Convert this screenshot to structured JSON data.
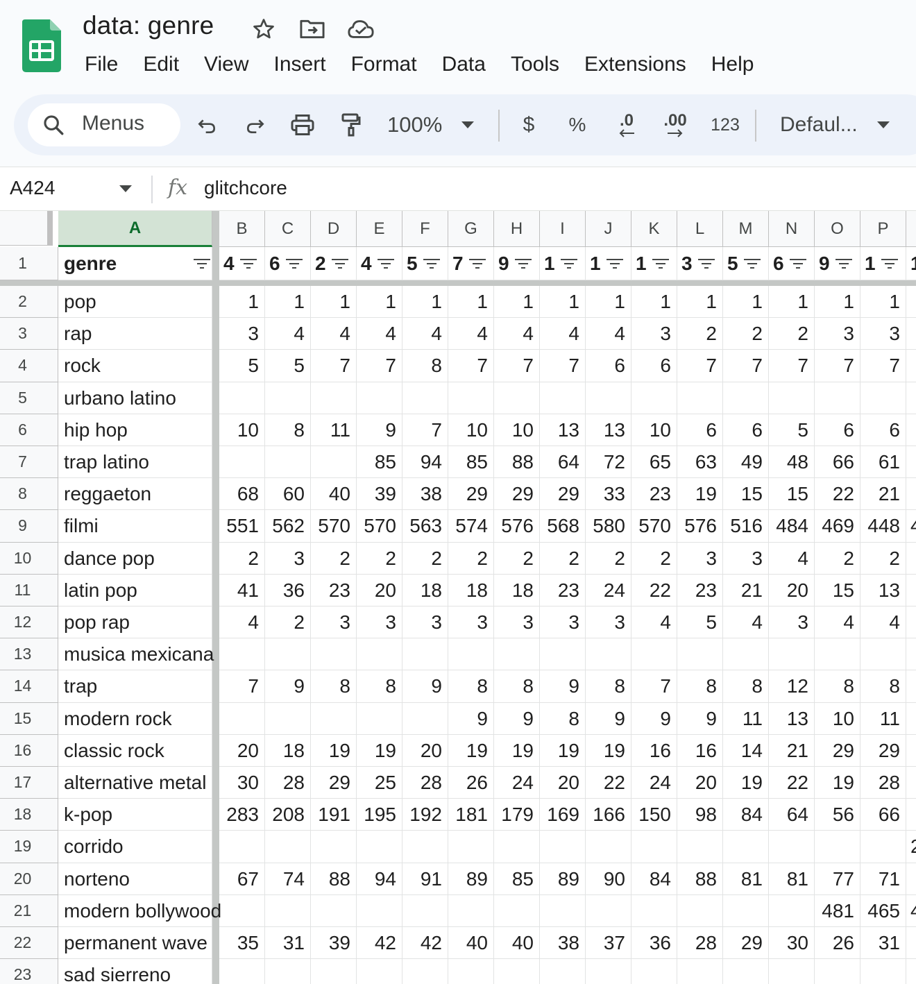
{
  "doc": {
    "title": "data: genre",
    "icons": [
      "star-icon",
      "move-to-folder-icon",
      "cloud-saved-icon"
    ]
  },
  "menus": [
    "File",
    "Edit",
    "View",
    "Insert",
    "Format",
    "Data",
    "Tools",
    "Extensions",
    "Help"
  ],
  "toolbar": {
    "search_label": "Menus",
    "zoom": "100%",
    "currency": "$",
    "percent": "%",
    "decrease_decimal": ".0",
    "increase_decimal": ".00",
    "number_format": "123",
    "font": "Defaul..."
  },
  "formula_bar": {
    "cell_ref": "A424",
    "fx": "fx",
    "value": "glitchcore"
  },
  "sheet": {
    "columns": [
      "A",
      "B",
      "C",
      "D",
      "E",
      "F",
      "G",
      "H",
      "I",
      "J",
      "K",
      "L",
      "M",
      "N",
      "O",
      "P"
    ],
    "selected_column": "A",
    "header_row": {
      "label": "genre",
      "values": [
        "4",
        "6",
        "2",
        "4",
        "5",
        "7",
        "9",
        "1",
        "1",
        "1",
        "3",
        "5",
        "6",
        "9",
        "1",
        "1"
      ]
    },
    "rows": [
      {
        "n": "2",
        "genre": "pop",
        "v": [
          "1",
          "1",
          "1",
          "1",
          "1",
          "1",
          "1",
          "1",
          "1",
          "1",
          "1",
          "1",
          "1",
          "1",
          "1"
        ],
        "overflow": ""
      },
      {
        "n": "3",
        "genre": "rap",
        "v": [
          "3",
          "4",
          "4",
          "4",
          "4",
          "4",
          "4",
          "4",
          "4",
          "3",
          "2",
          "2",
          "2",
          "3",
          "3"
        ],
        "overflow": ""
      },
      {
        "n": "4",
        "genre": "rock",
        "v": [
          "5",
          "5",
          "7",
          "7",
          "8",
          "7",
          "7",
          "7",
          "6",
          "6",
          "7",
          "7",
          "7",
          "7",
          "7"
        ],
        "overflow": ""
      },
      {
        "n": "5",
        "genre": "urbano latino",
        "v": [
          "",
          "",
          "",
          "",
          "",
          "",
          "",
          "",
          "",
          "",
          "",
          "",
          "",
          "",
          ""
        ],
        "overflow": ""
      },
      {
        "n": "6",
        "genre": "hip hop",
        "v": [
          "10",
          "8",
          "11",
          "9",
          "7",
          "10",
          "10",
          "13",
          "13",
          "10",
          "6",
          "6",
          "5",
          "6",
          "6"
        ],
        "overflow": ""
      },
      {
        "n": "7",
        "genre": "trap latino",
        "v": [
          "",
          "",
          "",
          "85",
          "94",
          "85",
          "88",
          "64",
          "72",
          "65",
          "63",
          "49",
          "48",
          "66",
          "61"
        ],
        "overflow": ""
      },
      {
        "n": "8",
        "genre": "reggaeton",
        "v": [
          "68",
          "60",
          "40",
          "39",
          "38",
          "29",
          "29",
          "29",
          "33",
          "23",
          "19",
          "15",
          "15",
          "22",
          "21"
        ],
        "overflow": ""
      },
      {
        "n": "9",
        "genre": "filmi",
        "v": [
          "551",
          "562",
          "570",
          "570",
          "563",
          "574",
          "576",
          "568",
          "580",
          "570",
          "576",
          "516",
          "484",
          "469",
          "448"
        ],
        "overflow": "4"
      },
      {
        "n": "10",
        "genre": "dance pop",
        "v": [
          "2",
          "3",
          "2",
          "2",
          "2",
          "2",
          "2",
          "2",
          "2",
          "2",
          "3",
          "3",
          "4",
          "2",
          "2"
        ],
        "overflow": ""
      },
      {
        "n": "11",
        "genre": "latin pop",
        "v": [
          "41",
          "36",
          "23",
          "20",
          "18",
          "18",
          "18",
          "23",
          "24",
          "22",
          "23",
          "21",
          "20",
          "15",
          "13"
        ],
        "overflow": ""
      },
      {
        "n": "12",
        "genre": "pop rap",
        "v": [
          "4",
          "2",
          "3",
          "3",
          "3",
          "3",
          "3",
          "3",
          "3",
          "4",
          "5",
          "4",
          "3",
          "4",
          "4"
        ],
        "overflow": ""
      },
      {
        "n": "13",
        "genre": "musica mexicana",
        "v": [
          "",
          "",
          "",
          "",
          "",
          "",
          "",
          "",
          "",
          "",
          "",
          "",
          "",
          "",
          ""
        ],
        "overflow": ""
      },
      {
        "n": "14",
        "genre": "trap",
        "v": [
          "7",
          "9",
          "8",
          "8",
          "9",
          "8",
          "8",
          "9",
          "8",
          "7",
          "8",
          "8",
          "12",
          "8",
          "8"
        ],
        "overflow": ""
      },
      {
        "n": "15",
        "genre": "modern rock",
        "v": [
          "",
          "",
          "",
          "",
          "",
          "9",
          "9",
          "8",
          "9",
          "9",
          "9",
          "11",
          "13",
          "10",
          "11"
        ],
        "overflow": ""
      },
      {
        "n": "16",
        "genre": "classic rock",
        "v": [
          "20",
          "18",
          "19",
          "19",
          "20",
          "19",
          "19",
          "19",
          "19",
          "16",
          "16",
          "14",
          "21",
          "29",
          "29"
        ],
        "overflow": ""
      },
      {
        "n": "17",
        "genre": "alternative metal",
        "v": [
          "30",
          "28",
          "29",
          "25",
          "28",
          "26",
          "24",
          "20",
          "22",
          "24",
          "20",
          "19",
          "22",
          "19",
          "28"
        ],
        "overflow": ""
      },
      {
        "n": "18",
        "genre": "k-pop",
        "v": [
          "283",
          "208",
          "191",
          "195",
          "192",
          "181",
          "179",
          "169",
          "166",
          "150",
          "98",
          "84",
          "64",
          "56",
          "66"
        ],
        "overflow": ""
      },
      {
        "n": "19",
        "genre": "corrido",
        "v": [
          "",
          "",
          "",
          "",
          "",
          "",
          "",
          "",
          "",
          "",
          "",
          "",
          "",
          "",
          ""
        ],
        "overflow": "2"
      },
      {
        "n": "20",
        "genre": "norteno",
        "v": [
          "67",
          "74",
          "88",
          "94",
          "91",
          "89",
          "85",
          "89",
          "90",
          "84",
          "88",
          "81",
          "81",
          "77",
          "71"
        ],
        "overflow": ""
      },
      {
        "n": "21",
        "genre": "modern bollywood",
        "v": [
          "",
          "",
          "",
          "",
          "",
          "",
          "",
          "",
          "",
          "",
          "",
          "",
          "",
          "481",
          "465"
        ],
        "overflow": "4"
      },
      {
        "n": "22",
        "genre": "permanent wave",
        "v": [
          "35",
          "31",
          "39",
          "42",
          "42",
          "40",
          "40",
          "38",
          "37",
          "36",
          "28",
          "29",
          "30",
          "26",
          "31"
        ],
        "overflow": ""
      },
      {
        "n": "23",
        "genre": "sad sierreno",
        "v": [
          "",
          "",
          "",
          "",
          "",
          "",
          "",
          "",
          "",
          "",
          "",
          "",
          "",
          "",
          ""
        ],
        "overflow": ""
      }
    ]
  },
  "colors": {
    "brand_green": "#188038",
    "selected_header_bg": "#d3e3d5",
    "toolbar_bg": "#edf2fa"
  }
}
